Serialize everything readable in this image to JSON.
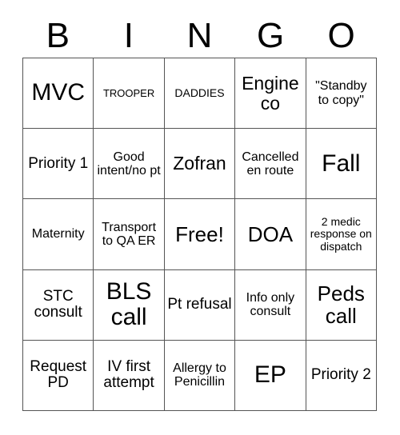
{
  "header": {
    "letters": [
      "B",
      "I",
      "N",
      "G",
      "O"
    ]
  },
  "grid": {
    "columns": 5,
    "rows": 5,
    "free_space_label": "Free!",
    "cells": [
      {
        "text": "MVC",
        "size": "xxl"
      },
      {
        "text": "TROOPER",
        "size": "xxs"
      },
      {
        "text": "DADDIES",
        "size": "xs"
      },
      {
        "text": "Engine co",
        "size": "l"
      },
      {
        "text": "\"Standby to copy\"",
        "size": "s"
      },
      {
        "text": "Priority 1",
        "size": "m"
      },
      {
        "text": "Good intent/no pt",
        "size": "s"
      },
      {
        "text": "Zofran",
        "size": "l"
      },
      {
        "text": "Cancelled en route",
        "size": "s"
      },
      {
        "text": "Fall",
        "size": "xxl"
      },
      {
        "text": "Maternity",
        "size": "s"
      },
      {
        "text": "Transport to QA ER",
        "size": "s"
      },
      {
        "text": "Free!",
        "size": "xl"
      },
      {
        "text": "DOA",
        "size": "xl"
      },
      {
        "text": "2 medic response on dispatch",
        "size": "xs"
      },
      {
        "text": "STC consult",
        "size": "m"
      },
      {
        "text": "BLS call",
        "size": "xxl"
      },
      {
        "text": "Pt refusal",
        "size": "m"
      },
      {
        "text": "Info only consult",
        "size": "s"
      },
      {
        "text": "Peds call",
        "size": "xl"
      },
      {
        "text": "Request PD",
        "size": "m"
      },
      {
        "text": "IV first attempt",
        "size": "m"
      },
      {
        "text": "Allergy to Penicillin",
        "size": "s"
      },
      {
        "text": "EP",
        "size": "xxl"
      },
      {
        "text": "Priority 2",
        "size": "m"
      }
    ]
  },
  "colors": {
    "background": "#ffffff",
    "text": "#000000",
    "border": "#555555"
  }
}
